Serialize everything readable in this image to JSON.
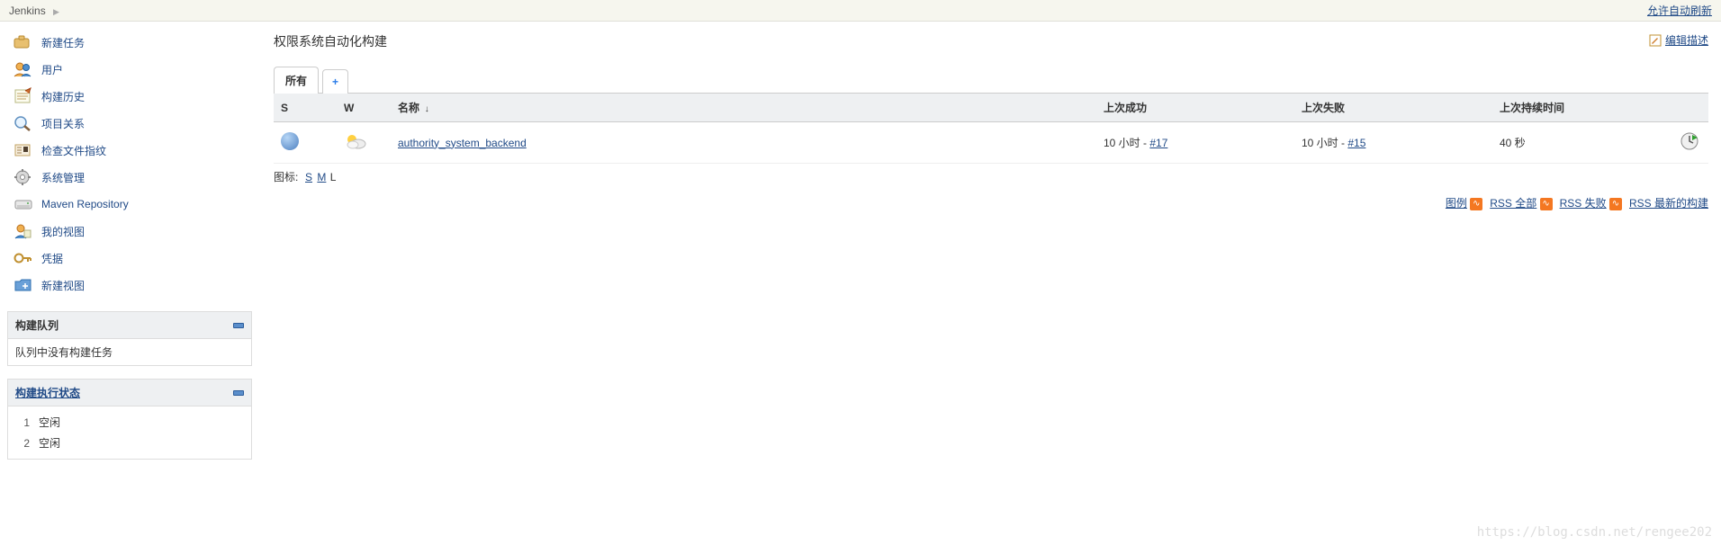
{
  "breadcrumb": {
    "root": "Jenkins",
    "auto_refresh": "允许自动刷新"
  },
  "sidebar": {
    "items": [
      {
        "label": "新建任务"
      },
      {
        "label": "用户"
      },
      {
        "label": "构建历史"
      },
      {
        "label": "项目关系"
      },
      {
        "label": "检查文件指纹"
      },
      {
        "label": "系统管理"
      },
      {
        "label": "Maven Repository"
      },
      {
        "label": "我的视图"
      },
      {
        "label": "凭据"
      },
      {
        "label": "新建视图"
      }
    ],
    "build_queue": {
      "title": "构建队列",
      "empty": "队列中没有构建任务"
    },
    "executors": {
      "title": "构建执行状态",
      "list": [
        {
          "num": "1",
          "state": "空闲"
        },
        {
          "num": "2",
          "state": "空闲"
        }
      ]
    }
  },
  "main": {
    "title": "权限系统自动化构建",
    "edit_desc": "编辑描述",
    "tabs": {
      "all": "所有",
      "add": "+"
    },
    "table": {
      "headers": {
        "s": "S",
        "w": "W",
        "name": "名称",
        "last_success": "上次成功",
        "last_failure": "上次失败",
        "last_duration": "上次持续时间"
      },
      "rows": [
        {
          "name": "authority_system_backend",
          "last_success_time": "10 小时 - ",
          "last_success_build": "#17",
          "last_failure_time": "10 小时 - ",
          "last_failure_build": "#15",
          "duration": "40 秒"
        }
      ]
    },
    "icon_size": {
      "label": "图标:",
      "s": "S",
      "m": "M",
      "l": "L"
    },
    "footer": {
      "legend": "图例",
      "rss_all": "RSS 全部",
      "rss_fail": "RSS 失败",
      "rss_latest": "RSS 最新的构建"
    }
  },
  "watermark": "https://blog.csdn.net/rengee202"
}
